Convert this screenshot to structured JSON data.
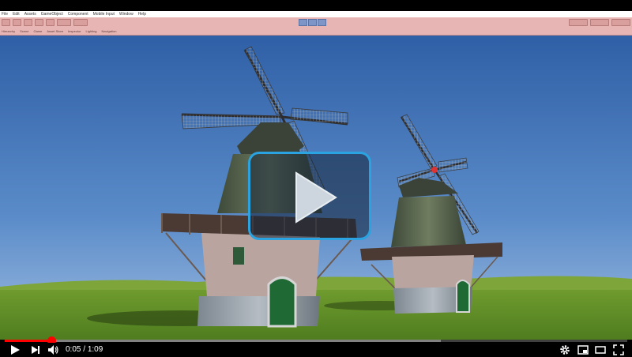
{
  "editor": {
    "menu": [
      "File",
      "Edit",
      "Assets",
      "GameObject",
      "Component",
      "Mobile Input",
      "Window",
      "Help"
    ],
    "tabs": [
      "Hierarchy",
      "Scene",
      "Game",
      "Asset Store",
      "Inspector",
      "Lighting",
      "Navigation"
    ]
  },
  "player": {
    "time_current": "0:05",
    "time_separator": " / ",
    "time_total": "1:09",
    "progress_fraction": 0.076,
    "buffer_fraction": 0.7
  },
  "colors": {
    "accent": "#ff0000",
    "overlay_border": "#2aa3e0",
    "editor_tint": "#e7b6b4"
  },
  "icons": {
    "play": "play-icon",
    "next": "next-icon",
    "volume": "volume-icon",
    "settings": "gear-icon",
    "miniplayer": "miniplayer-icon",
    "theater": "theater-icon",
    "fullscreen": "fullscreen-icon"
  }
}
